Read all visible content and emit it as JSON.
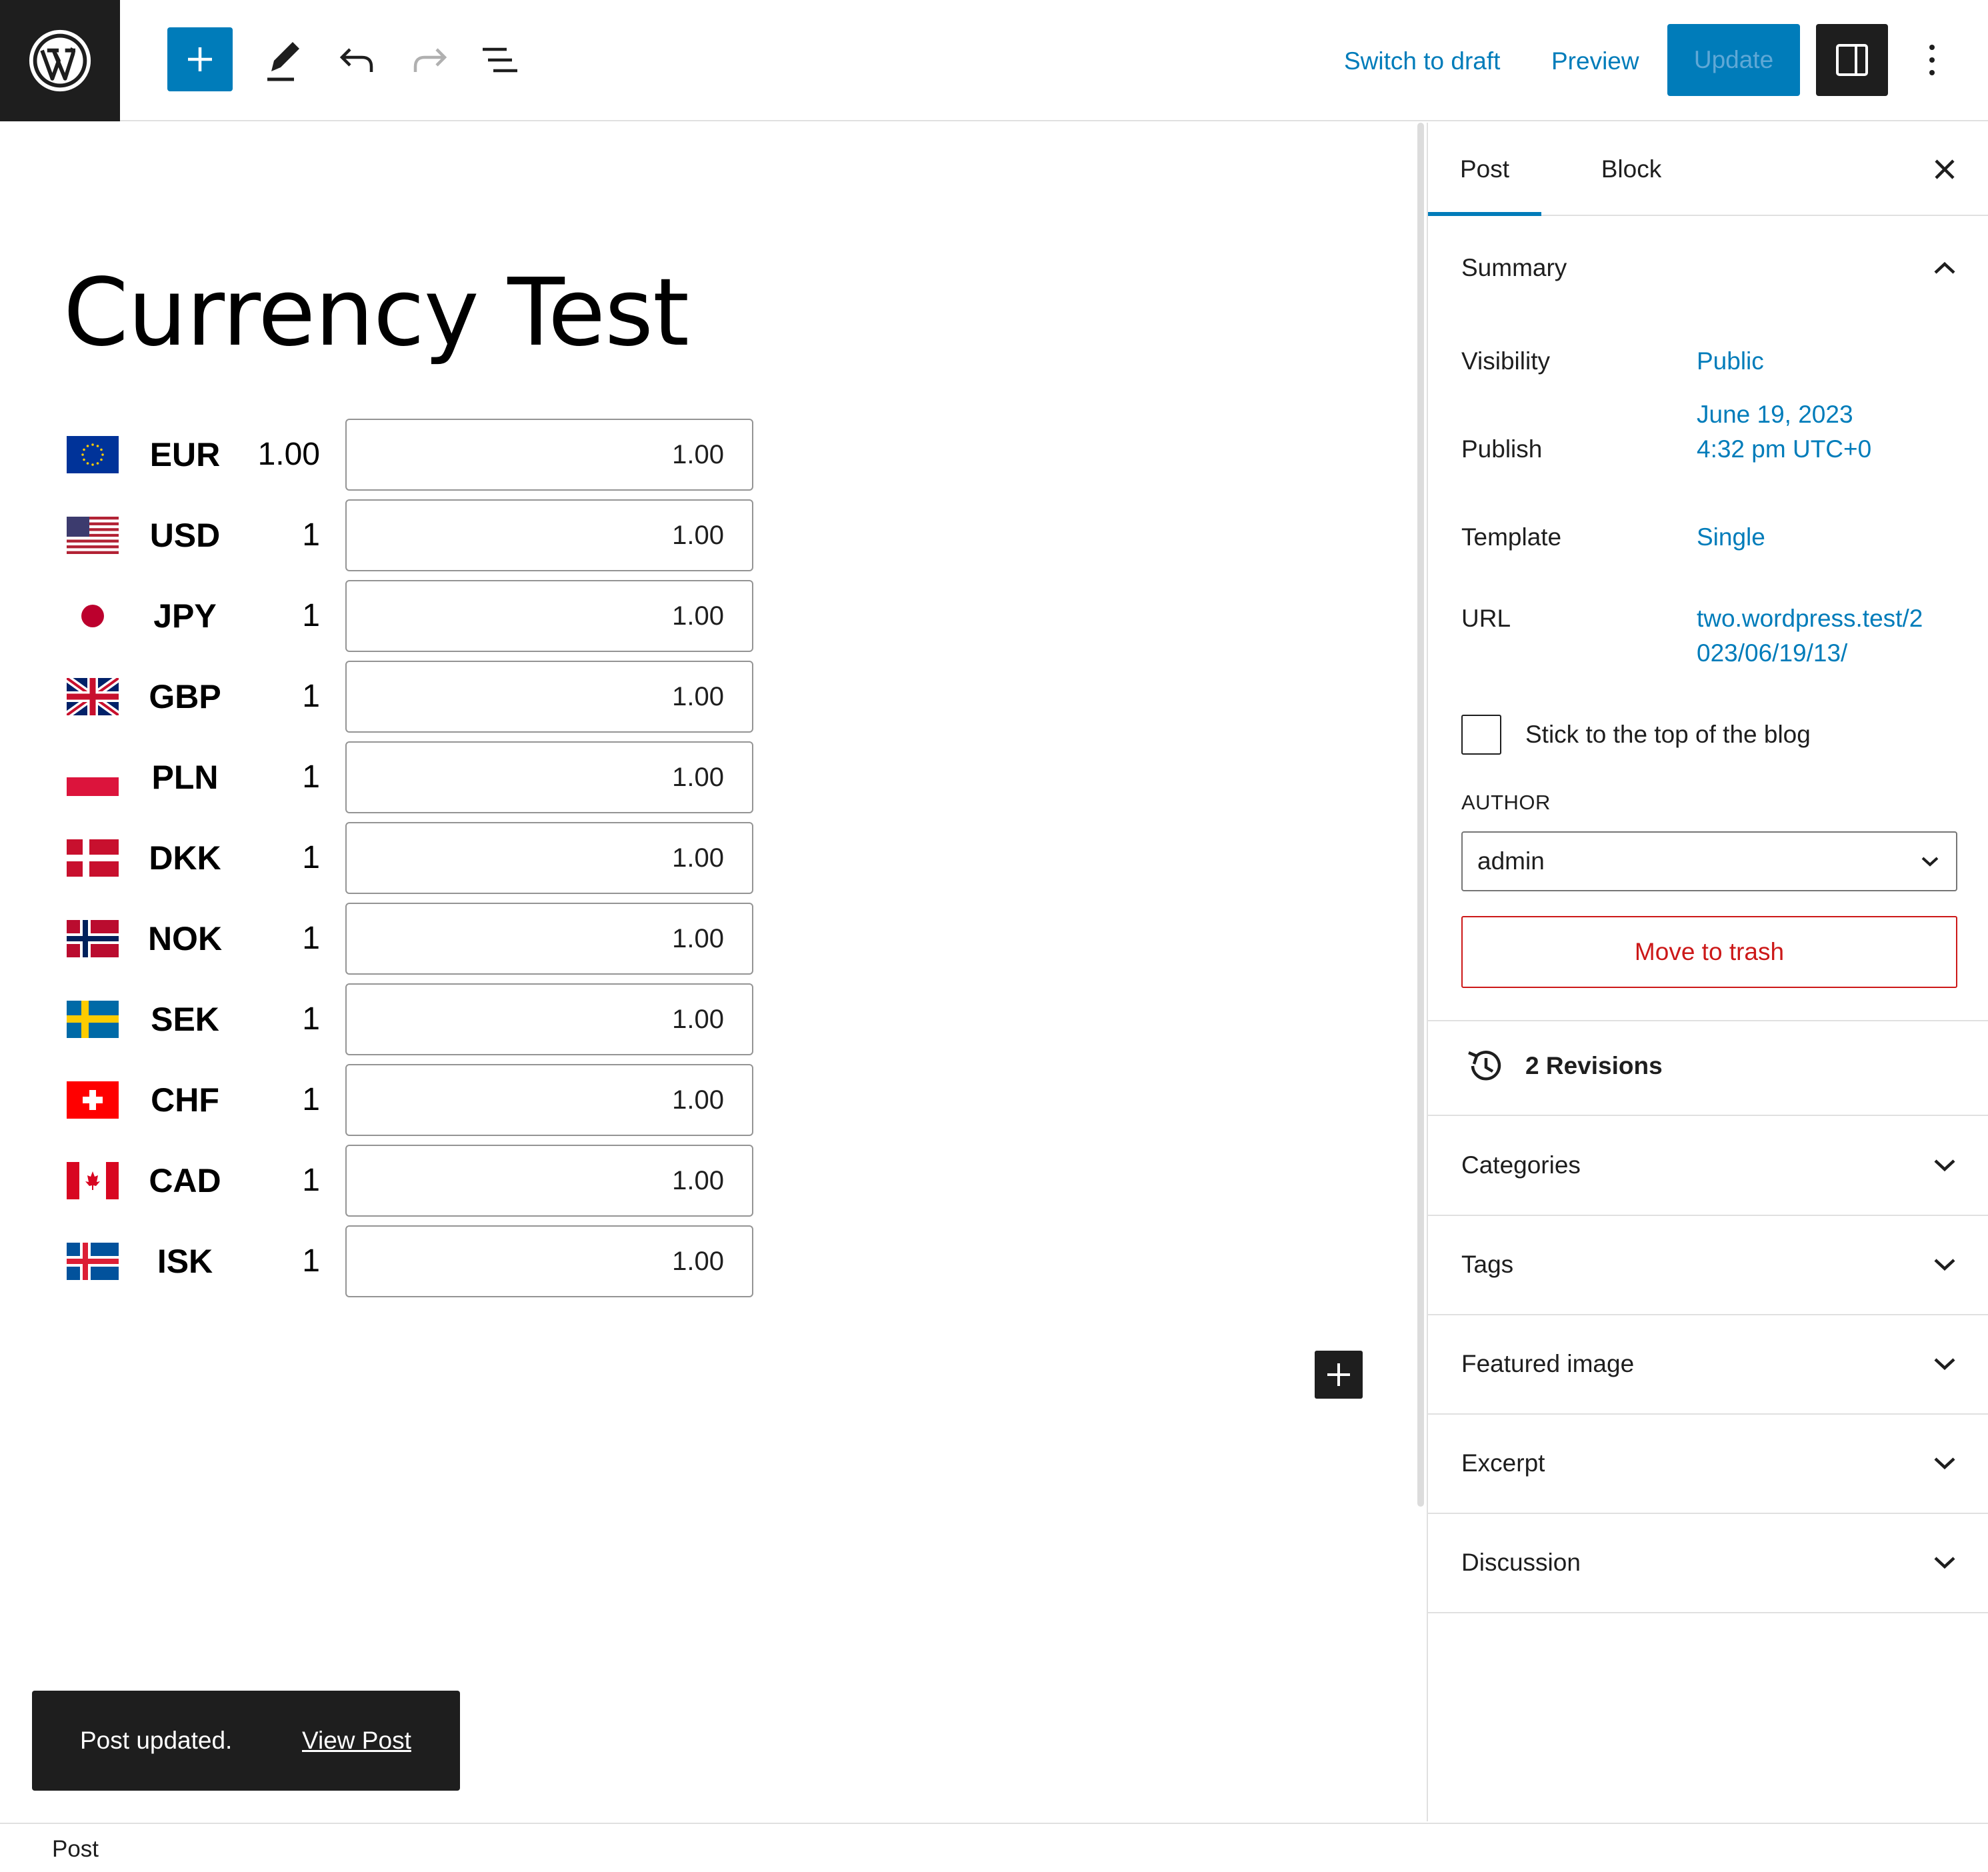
{
  "toolbar": {
    "switch_to_draft": "Switch to draft",
    "preview": "Preview",
    "update": "Update"
  },
  "editor": {
    "title": "Currency Test"
  },
  "currencies": [
    {
      "code": "EUR",
      "rate": "1.00",
      "amount": "1.00",
      "flag": "eu-flag-icon"
    },
    {
      "code": "USD",
      "rate": "1",
      "amount": "1.00",
      "flag": "us-flag-icon"
    },
    {
      "code": "JPY",
      "rate": "1",
      "amount": "1.00",
      "flag": "jp-flag-icon"
    },
    {
      "code": "GBP",
      "rate": "1",
      "amount": "1.00",
      "flag": "gb-flag-icon"
    },
    {
      "code": "PLN",
      "rate": "1",
      "amount": "1.00",
      "flag": "pl-flag-icon"
    },
    {
      "code": "DKK",
      "rate": "1",
      "amount": "1.00",
      "flag": "dk-flag-icon"
    },
    {
      "code": "NOK",
      "rate": "1",
      "amount": "1.00",
      "flag": "no-flag-icon"
    },
    {
      "code": "SEK",
      "rate": "1",
      "amount": "1.00",
      "flag": "se-flag-icon"
    },
    {
      "code": "CHF",
      "rate": "1",
      "amount": "1.00",
      "flag": "ch-flag-icon"
    },
    {
      "code": "CAD",
      "rate": "1",
      "amount": "1.00",
      "flag": "ca-flag-icon"
    },
    {
      "code": "ISK",
      "rate": "1",
      "amount": "1.00",
      "flag": "is-flag-icon"
    }
  ],
  "sidebar": {
    "tabs": [
      "Post",
      "Block"
    ],
    "summary": {
      "title": "Summary",
      "visibility_label": "Visibility",
      "visibility_value": "Public",
      "publish_label": "Publish",
      "publish_date": "June 19, 2023",
      "publish_time": "4:32 pm UTC+0",
      "template_label": "Template",
      "template_value": "Single",
      "url_label": "URL",
      "url_line1": "two.wordpress.test/2",
      "url_line2": "023/06/19/13/",
      "sticky_label": "Stick to the top of the blog",
      "author_label": "AUTHOR",
      "author_value": "admin",
      "trash": "Move to trash"
    },
    "revisions": "2 Revisions",
    "panels": [
      "Categories",
      "Tags",
      "Featured image",
      "Excerpt",
      "Discussion"
    ]
  },
  "snackbar": {
    "message": "Post updated.",
    "link": "View Post"
  },
  "footer": {
    "breadcrumb": "Post"
  },
  "colors": {
    "accent": "#007cba",
    "dark": "#1e1e1e",
    "danger": "#cc1818"
  }
}
